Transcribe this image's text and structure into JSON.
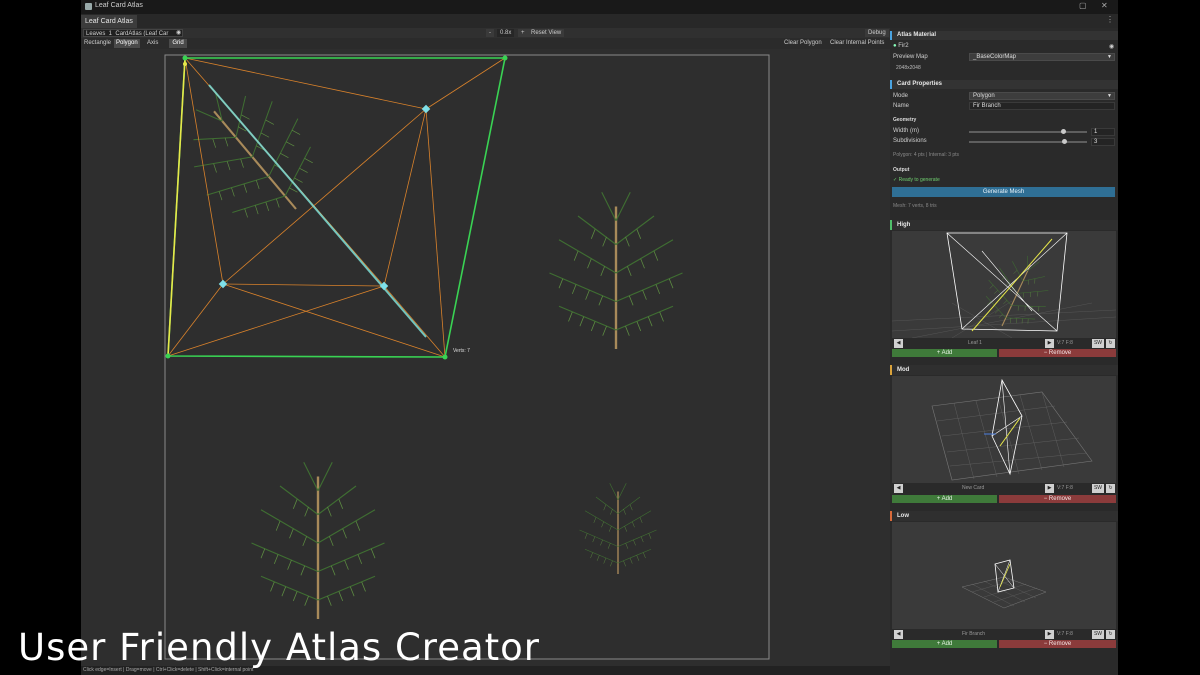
{
  "window": {
    "title": "Leaf Card Atlas",
    "tab": "Leaf Card Atlas"
  },
  "toolbar": {
    "asset_field": "Leaves_1_CardAtlas (Leaf Car",
    "zoom_minus": "-",
    "zoom_level": "0.8x",
    "zoom_plus": "+",
    "reset_view": "Reset View",
    "debug": "Debug",
    "modes": [
      "Rectangle",
      "Polygon",
      "Axis",
      "Grid"
    ],
    "clear_polygon": "Clear Polygon",
    "clear_internal_points": "Clear Internal Points"
  },
  "canvas": {
    "verts_label": "Verts: 7"
  },
  "statusbar": {
    "text": "Click edge=Insert | Drag=move | Ctrl+Click=delete | Shift+Click=internal point"
  },
  "inspector": {
    "atlas_material": {
      "header": "Atlas Material",
      "material": "Fir2",
      "preview_map_label": "Preview Map",
      "preview_map_value": "_BaseColorMap",
      "resolution": "2048x2048"
    },
    "card_properties": {
      "header": "Card Properties",
      "mode_label": "Mode",
      "mode_value": "Polygon",
      "name_label": "Name",
      "name_value": "Fir Branch",
      "geometry_header": "Geometry",
      "width_label": "Width (m)",
      "width_value": "1",
      "subdivisions_label": "Subdivisions",
      "subdivisions_value": "3",
      "polygon_info": "Polygon: 4 pts  |  Internal: 3 pts",
      "output_header": "Output",
      "ready_text": "✓ Ready to generate",
      "generate_button": "Generate Mesh",
      "mesh_info": "Mesh: 7 verts, 8 tris"
    },
    "lods": [
      {
        "header": "High",
        "caption": "Leaf 1",
        "stats": "V:7 F:8",
        "sw": "SW",
        "add": "+ Add",
        "remove": "− Remove"
      },
      {
        "header": "Mod",
        "caption": "New Card",
        "stats": "V:7 F:8",
        "sw": "SW",
        "add": "+ Add",
        "remove": "− Remove"
      },
      {
        "header": "Low",
        "caption": "Fir Branch",
        "stats": "V:7 F:8",
        "sw": "SW",
        "add": "+ Add",
        "remove": "− Remove"
      }
    ]
  },
  "overlay": {
    "caption": "User Friendly Atlas Creator"
  },
  "colors": {
    "accent_blue": "#2f6f95",
    "add_green": "#3f7a3a",
    "remove_red": "#8b3b3b",
    "polygon_green": "#39d353",
    "edge_yellow": "#e8e84a",
    "triangulation_orange": "#d9822b",
    "axis_cyan": "#7fe0d8"
  },
  "icons": [
    "unity-logo-icon",
    "minimize-icon",
    "maximize-icon",
    "close-icon",
    "kebab-menu-icon",
    "object-picker-icon",
    "material-icon",
    "dropdown-arrow-icon",
    "prev-arrow-icon",
    "next-arrow-icon",
    "refresh-icon"
  ]
}
